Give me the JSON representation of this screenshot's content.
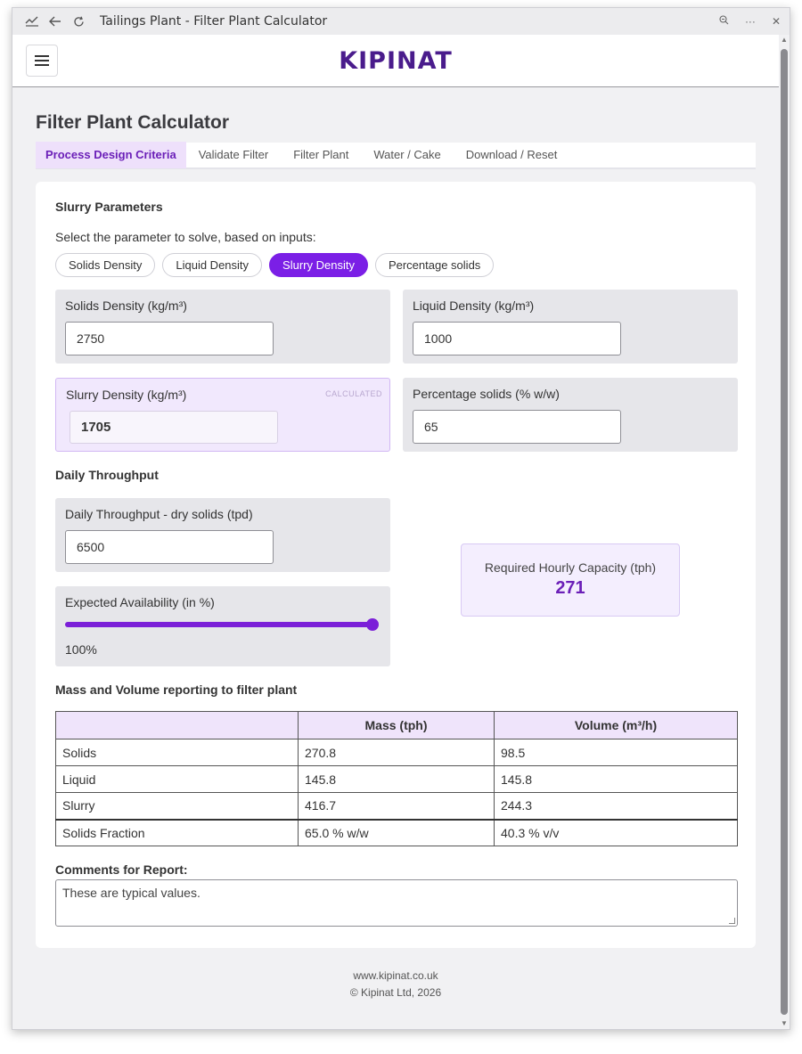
{
  "window": {
    "title": "Tailings Plant - Filter Plant Calculator",
    "controls": [
      "zoom-icon",
      "more-icon",
      "close-icon"
    ]
  },
  "header": {
    "logo": "KIPINAT"
  },
  "page": {
    "title": "Filter Plant Calculator",
    "tabs": [
      {
        "label": "Process Design Criteria",
        "active": true
      },
      {
        "label": "Validate Filter"
      },
      {
        "label": "Filter Plant"
      },
      {
        "label": "Water / Cake"
      },
      {
        "label": "Download / Reset"
      }
    ]
  },
  "slurry": {
    "section_title": "Slurry Parameters",
    "prompt": "Select the parameter to solve, based on inputs:",
    "options": [
      "Solids Density",
      "Liquid Density",
      "Slurry Density",
      "Percentage solids"
    ],
    "selected_option": "Slurry Density",
    "solids_density": {
      "label": "Solids Density (kg/m³)",
      "value": "2750"
    },
    "liquid_density": {
      "label": "Liquid Density (kg/m³)",
      "value": "1000"
    },
    "slurry_density": {
      "label": "Slurry Density (kg/m³)",
      "value": "1705",
      "tag": "CALCULATED"
    },
    "percent_solids": {
      "label": "Percentage solids (% w/w)",
      "value": "65"
    }
  },
  "throughput": {
    "section_title": "Daily Throughput",
    "daily": {
      "label": "Daily Throughput - dry solids (tpd)",
      "value": "6500"
    },
    "availability": {
      "label": "Expected Availability (in %)",
      "value_text": "100%",
      "level": 1.0
    },
    "capacity": {
      "label": "Required Hourly Capacity (tph)",
      "value": "271"
    }
  },
  "mass_volume": {
    "section_title": "Mass and Volume reporting to filter plant",
    "headers": [
      "",
      "Mass (tph)",
      "Volume (m³/h)"
    ],
    "rows": [
      [
        "Solids",
        "270.8",
        "98.5"
      ],
      [
        "Liquid",
        "145.8",
        "145.8"
      ],
      [
        "Slurry",
        "416.7",
        "244.3"
      ],
      [
        "Solids Fraction",
        "65.0 % w/w",
        "40.3 % v/v"
      ]
    ]
  },
  "comments": {
    "label": "Comments for Report:",
    "value": "These are typical values."
  },
  "footer": {
    "website": "www.kipinat.co.uk",
    "copyright": "© Kipinat Ltd, 2026"
  },
  "colors": {
    "accent": "#7b1fd8",
    "brand": "#4a1c8c",
    "calc_bg": "#f1e8fd"
  }
}
